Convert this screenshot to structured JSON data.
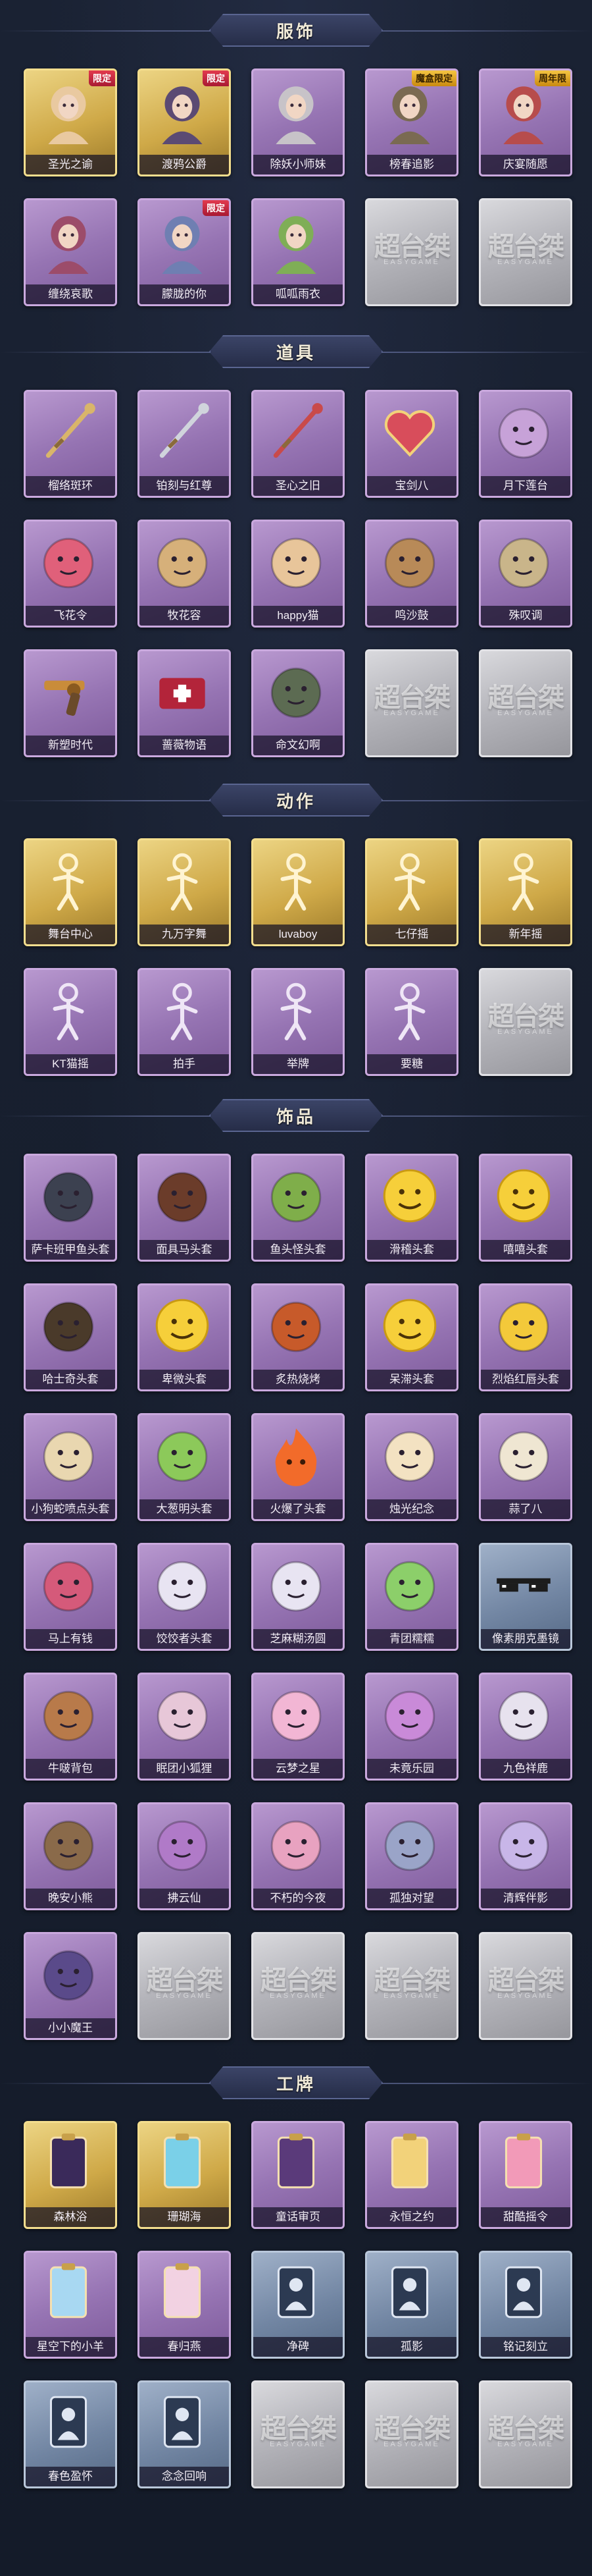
{
  "sections": [
    {
      "title": "服饰",
      "items": [
        {
          "label": "圣光之谕",
          "style": "gold",
          "badge": "限定",
          "icon": "character-portrait-icon",
          "color": "#e9c9a0"
        },
        {
          "label": "渡鸦公爵",
          "style": "gold",
          "badge": "限定",
          "icon": "character-portrait-icon",
          "color": "#5b4a73"
        },
        {
          "label": "除妖小师妹",
          "style": "purple",
          "badge": "",
          "icon": "character-portrait-icon",
          "color": "#c7c3c8"
        },
        {
          "label": "榜春追影",
          "style": "purple",
          "badge": "魔盒限定",
          "icon": "character-portrait-icon",
          "color": "#7a6a52"
        },
        {
          "label": "庆宴随愿",
          "style": "purple",
          "badge": "周年限",
          "icon": "character-portrait-icon",
          "color": "#b74c4c"
        },
        {
          "label": "缠绕哀歌",
          "style": "purple",
          "badge": "",
          "icon": "character-portrait-icon",
          "color": "#9c4c6a"
        },
        {
          "label": "朦胧的你",
          "style": "purple",
          "badge": "限定",
          "icon": "character-portrait-icon",
          "color": "#6f7fb2"
        },
        {
          "label": "呱呱雨衣",
          "style": "purple",
          "badge": "",
          "icon": "character-portrait-icon",
          "color": "#7fae56"
        },
        {
          "label": "",
          "style": "empty",
          "badge": "",
          "icon": "placeholder-logo-icon",
          "color": ""
        },
        {
          "label": "",
          "style": "empty",
          "badge": "",
          "icon": "placeholder-logo-icon",
          "color": ""
        }
      ]
    },
    {
      "title": "道具",
      "items": [
        {
          "label": "榴络斑环",
          "style": "purple",
          "badge": "",
          "icon": "staff-icon",
          "color": "#d9b56a"
        },
        {
          "label": "铂刻与红尊",
          "style": "purple",
          "badge": "",
          "icon": "sword-icon",
          "color": "#d0d4dc"
        },
        {
          "label": "圣心之旧",
          "style": "purple",
          "badge": "",
          "icon": "scepter-icon",
          "color": "#c94a4a"
        },
        {
          "label": "宝剑八",
          "style": "purple",
          "badge": "",
          "icon": "heart-emblem-icon",
          "color": "#d84d5b"
        },
        {
          "label": "月下莲台",
          "style": "purple",
          "badge": "",
          "icon": "lantern-icon",
          "color": "#c7a2d8"
        },
        {
          "label": "飞花令",
          "style": "purple",
          "badge": "",
          "icon": "flower-bouquet-icon",
          "color": "#e0607a"
        },
        {
          "label": "牧花容",
          "style": "purple",
          "badge": "",
          "icon": "ornament-icon",
          "color": "#d6b07a"
        },
        {
          "label": "happy猫",
          "style": "purple",
          "badge": "",
          "icon": "cat-figure-icon",
          "color": "#e8c59a"
        },
        {
          "label": "鸣沙鼓",
          "style": "purple",
          "badge": "",
          "icon": "drum-icon",
          "color": "#b88a58"
        },
        {
          "label": "殊叹调",
          "style": "purple",
          "badge": "",
          "icon": "tree-ornament-icon",
          "color": "#c9b58a"
        },
        {
          "label": "新塑时代",
          "style": "purple",
          "badge": "",
          "icon": "revolver-icon",
          "color": "#c98c3a"
        },
        {
          "label": "蔷薇物语",
          "style": "purple",
          "badge": "",
          "icon": "medical-kit-icon",
          "color": "#b3243a"
        },
        {
          "label": "命文幻啊",
          "style": "purple",
          "badge": "",
          "icon": "lantern-small-icon",
          "color": "#5c6b52"
        },
        {
          "label": "",
          "style": "empty",
          "badge": "",
          "icon": "placeholder-logo-icon",
          "color": ""
        },
        {
          "label": "",
          "style": "empty",
          "badge": "",
          "icon": "placeholder-logo-icon",
          "color": ""
        }
      ]
    },
    {
      "title": "动作",
      "items": [
        {
          "label": "舞台中心",
          "style": "gold",
          "badge": "",
          "icon": "pose-figure-icon",
          "color": "#fff4d2"
        },
        {
          "label": "九万字舞",
          "style": "gold",
          "badge": "",
          "icon": "pose-figure-icon",
          "color": "#fff4d2"
        },
        {
          "label": "luvaboy",
          "style": "gold",
          "badge": "",
          "icon": "pose-figure-icon",
          "color": "#fff4d2"
        },
        {
          "label": "七仔摇",
          "style": "gold",
          "badge": "",
          "icon": "pose-figure-icon",
          "color": "#fff4d2"
        },
        {
          "label": "新年摇",
          "style": "gold",
          "badge": "",
          "icon": "pose-figure-icon",
          "color": "#fff4d2"
        },
        {
          "label": "KT猫摇",
          "style": "purple",
          "badge": "",
          "icon": "pose-figure-icon",
          "color": "#efe6f6"
        },
        {
          "label": "拍手",
          "style": "purple",
          "badge": "",
          "icon": "pose-figure-icon",
          "color": "#efe6f6"
        },
        {
          "label": "举牌",
          "style": "purple",
          "badge": "",
          "icon": "pose-figure-icon",
          "color": "#efe6f6"
        },
        {
          "label": "要糖",
          "style": "purple",
          "badge": "",
          "icon": "pose-figure-icon",
          "color": "#efe6f6"
        },
        {
          "label": "",
          "style": "empty",
          "badge": "",
          "icon": "placeholder-logo-icon",
          "color": ""
        }
      ]
    },
    {
      "title": "饰品",
      "items": [
        {
          "label": "萨卡班甲鱼头套",
          "style": "purple",
          "badge": "",
          "icon": "fish-head-icon",
          "color": "#3c4150"
        },
        {
          "label": "面具马头套",
          "style": "purple",
          "badge": "",
          "icon": "horse-head-icon",
          "color": "#6b3c2a"
        },
        {
          "label": "鱼头怪头套",
          "style": "purple",
          "badge": "",
          "icon": "fish-monster-icon",
          "color": "#7fae4a"
        },
        {
          "label": "滑稽头套",
          "style": "purple",
          "badge": "",
          "icon": "emoji-face-icon",
          "color": "#f6cf3a"
        },
        {
          "label": "嘻嘻头套",
          "style": "purple",
          "badge": "",
          "icon": "emoji-face-icon",
          "color": "#f6cf3a"
        },
        {
          "label": "哈士奇头套",
          "style": "purple",
          "badge": "",
          "icon": "dog-head-icon",
          "color": "#4a3a2a"
        },
        {
          "label": "卑微头套",
          "style": "purple",
          "badge": "",
          "icon": "emoji-face-icon",
          "color": "#f6cf3a"
        },
        {
          "label": "炙热烧烤",
          "style": "purple",
          "badge": "",
          "icon": "bbq-icon",
          "color": "#c75a2a"
        },
        {
          "label": "呆滞头套",
          "style": "purple",
          "badge": "",
          "icon": "emoji-face-icon",
          "color": "#f6cf3a"
        },
        {
          "label": "烈焰红唇头套",
          "style": "purple",
          "badge": "",
          "icon": "pikachu-head-icon",
          "color": "#f3c93a"
        },
        {
          "label": "小狗蛇喷点头套",
          "style": "purple",
          "badge": "",
          "icon": "creature-head-icon",
          "color": "#e9d7b0"
        },
        {
          "label": "大葱明头套",
          "style": "purple",
          "badge": "",
          "icon": "vegetable-head-icon",
          "color": "#8cc95a"
        },
        {
          "label": "火爆了头套",
          "style": "purple",
          "badge": "",
          "icon": "fire-head-icon",
          "color": "#f26b2a"
        },
        {
          "label": "烛光纪念",
          "style": "purple",
          "badge": "",
          "icon": "candle-head-icon",
          "color": "#f3e2c2"
        },
        {
          "label": "蒜了八",
          "style": "purple",
          "badge": "",
          "icon": "garlic-head-icon",
          "color": "#efe6d2"
        },
        {
          "label": "马上有钱",
          "style": "purple",
          "badge": "",
          "icon": "plush-head-icon",
          "color": "#d55a7a"
        },
        {
          "label": "饺饺者头套",
          "style": "purple",
          "badge": "",
          "icon": "dumpling-head-icon",
          "color": "#e8e4f2"
        },
        {
          "label": "芝麻糊汤圆",
          "style": "purple",
          "badge": "",
          "icon": "tangyuan-head-icon",
          "color": "#e8e4f2"
        },
        {
          "label": "青团糯糯",
          "style": "purple",
          "badge": "",
          "icon": "green-mochi-icon",
          "color": "#8ccf6a"
        },
        {
          "label": "像素朋克墨镜",
          "style": "blue",
          "badge": "",
          "icon": "pixel-sunglasses-icon",
          "color": "#1c1c1c"
        },
        {
          "label": "牛啵背包",
          "style": "purple",
          "badge": "",
          "icon": "backpack-icon",
          "color": "#b87a4a"
        },
        {
          "label": "眠团小狐狸",
          "style": "purple",
          "badge": "",
          "icon": "fox-pendant-icon",
          "color": "#e7c7d8"
        },
        {
          "label": "云梦之星",
          "style": "purple",
          "badge": "",
          "icon": "unicorn-icon",
          "color": "#f2b6d4"
        },
        {
          "label": "未竟乐园",
          "style": "purple",
          "badge": "",
          "icon": "doll-icon",
          "color": "#c98ad8"
        },
        {
          "label": "九色祥鹿",
          "style": "purple",
          "badge": "",
          "icon": "deer-icon",
          "color": "#e7e2ee"
        },
        {
          "label": "晚安小熊",
          "style": "purple",
          "badge": "",
          "icon": "bear-pendant-icon",
          "color": "#8a6a4a"
        },
        {
          "label": "拂云仙",
          "style": "purple",
          "badge": "",
          "icon": "fairy-pendant-icon",
          "color": "#b07ac8"
        },
        {
          "label": "不朽的今夜",
          "style": "purple",
          "badge": "",
          "icon": "rabbit-pendant-icon",
          "color": "#e8a2c0"
        },
        {
          "label": "孤独对望",
          "style": "purple",
          "badge": "",
          "icon": "doll-pendant-icon",
          "color": "#9aa4c8"
        },
        {
          "label": "清辉伴影",
          "style": "purple",
          "badge": "",
          "icon": "spirit-pendant-icon",
          "color": "#c8b6e8"
        },
        {
          "label": "小小魔王",
          "style": "purple",
          "badge": "",
          "icon": "demon-doll-icon",
          "color": "#5a4a8a"
        },
        {
          "label": "",
          "style": "empty",
          "badge": "",
          "icon": "placeholder-logo-icon",
          "color": ""
        },
        {
          "label": "",
          "style": "empty",
          "badge": "",
          "icon": "placeholder-logo-icon",
          "color": ""
        },
        {
          "label": "",
          "style": "empty",
          "badge": "",
          "icon": "placeholder-logo-icon",
          "color": ""
        },
        {
          "label": "",
          "style": "empty",
          "badge": "",
          "icon": "placeholder-logo-icon",
          "color": ""
        }
      ]
    },
    {
      "title": "工牌",
      "items": [
        {
          "label": "森林浴",
          "style": "gold",
          "badge": "",
          "icon": "badge-card-icon",
          "color": "#3a2a5a"
        },
        {
          "label": "珊瑚海",
          "style": "gold",
          "badge": "",
          "icon": "badge-card-icon",
          "color": "#7ad0e8"
        },
        {
          "label": "童话审页",
          "style": "purple",
          "badge": "",
          "icon": "badge-card-icon",
          "color": "#5a3a7a"
        },
        {
          "label": "永恒之约",
          "style": "purple",
          "badge": "",
          "icon": "badge-card-icon",
          "color": "#f2d27a"
        },
        {
          "label": "甜酷摇令",
          "style": "purple",
          "badge": "",
          "icon": "badge-card-icon",
          "color": "#f29ab8"
        },
        {
          "label": "星空下的小羊",
          "style": "purple",
          "badge": "",
          "icon": "badge-card-icon",
          "color": "#a8d8f2"
        },
        {
          "label": "春归燕",
          "style": "purple",
          "badge": "",
          "icon": "badge-card-icon",
          "color": "#f2d2e2"
        },
        {
          "label": "净碑",
          "style": "blue",
          "badge": "",
          "icon": "silhouette-card-icon",
          "color": "#2c3a52"
        },
        {
          "label": "孤影",
          "style": "blue",
          "badge": "",
          "icon": "silhouette-card-icon",
          "color": "#2c3a52"
        },
        {
          "label": "铭记刻立",
          "style": "blue",
          "badge": "",
          "icon": "silhouette-card-icon",
          "color": "#2c3a52"
        },
        {
          "label": "春色盈怀",
          "style": "blue",
          "badge": "",
          "icon": "silhouette-card-icon",
          "color": "#2c3a52"
        },
        {
          "label": "念念回响",
          "style": "blue",
          "badge": "",
          "icon": "silhouette-card-icon",
          "color": "#2c3a52"
        },
        {
          "label": "",
          "style": "empty",
          "badge": "",
          "icon": "placeholder-logo-icon",
          "color": ""
        },
        {
          "label": "",
          "style": "empty",
          "badge": "",
          "icon": "placeholder-logo-icon",
          "color": ""
        },
        {
          "label": "",
          "style": "empty",
          "badge": "",
          "icon": "placeholder-logo-icon",
          "color": ""
        }
      ]
    }
  ],
  "placeholder": {
    "text": "超台桀",
    "subtext": "EASYGAME"
  }
}
